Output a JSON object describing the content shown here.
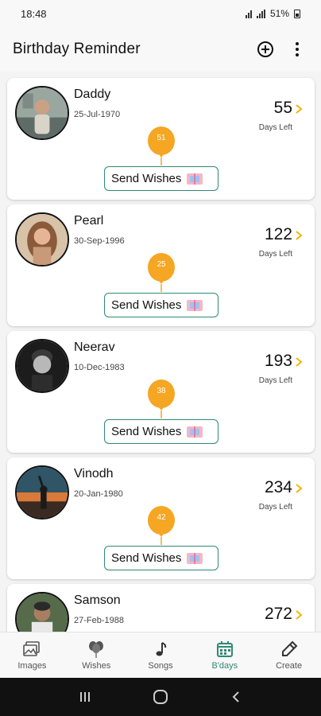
{
  "status_bar": {
    "time": "18:48",
    "battery": "51%"
  },
  "app_bar": {
    "title": "Birthday Reminder",
    "actions": [
      "add-icon",
      "more-vert-icon"
    ]
  },
  "colors": {
    "accent": "#2e8a74",
    "balloon": "#f5a623",
    "chevron": "#f5b400"
  },
  "birthdays": [
    {
      "name": "Daddy",
      "date": "25-Jul-1970",
      "days": "55",
      "days_label": "Days Left",
      "age": "51",
      "button": "Send Wishes"
    },
    {
      "name": "Pearl",
      "date": "30-Sep-1996",
      "days": "122",
      "days_label": "Days Left",
      "age": "25",
      "button": "Send Wishes"
    },
    {
      "name": "Neerav",
      "date": "10-Dec-1983",
      "days": "193",
      "days_label": "Days Left",
      "age": "38",
      "button": "Send Wishes"
    },
    {
      "name": "Vinodh",
      "date": "20-Jan-1980",
      "days": "234",
      "days_label": "Days Left",
      "age": "42",
      "button": "Send Wishes"
    },
    {
      "name": "Samson",
      "date": "27-Feb-1988",
      "days": "272",
      "days_label": "",
      "age": "",
      "button": ""
    }
  ],
  "bottom_nav": [
    {
      "label": "Images",
      "icon": "images-icon",
      "active": false
    },
    {
      "label": "Wishes",
      "icon": "balloons-icon",
      "active": false
    },
    {
      "label": "Songs",
      "icon": "music-note-icon",
      "active": false
    },
    {
      "label": "B'days",
      "icon": "calendar-icon",
      "active": true
    },
    {
      "label": "Create",
      "icon": "pencil-icon",
      "active": false
    }
  ]
}
